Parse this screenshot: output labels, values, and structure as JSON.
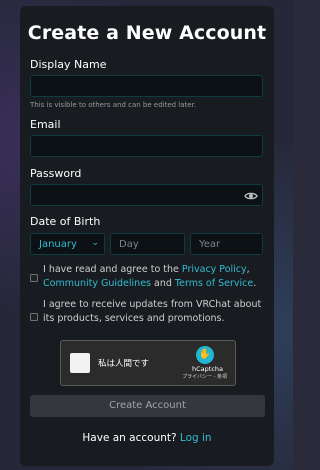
{
  "title": "Create a New Account",
  "display_name": {
    "label": "Display Name",
    "value": "",
    "hint": "This is visible to others and can be edited later."
  },
  "email": {
    "label": "Email",
    "value": ""
  },
  "password": {
    "label": "Password",
    "value": "",
    "toggle_icon": "eye-icon"
  },
  "dob": {
    "label": "Date of Birth",
    "month": "January",
    "day_placeholder": "Day",
    "year_placeholder": "Year"
  },
  "agree_tos": {
    "checked": false,
    "text_before": "I have read and agree to the ",
    "privacy": "Privacy Policy",
    "comma": ",",
    "community": "Community Guidelines",
    "and": " and ",
    "terms": "Terms of Service",
    "period": "."
  },
  "agree_updates": {
    "checked": false,
    "text": "I agree to receive updates from VRChat about its products, services and promotions."
  },
  "captcha": {
    "label": "私は人間です",
    "brand": "hCaptcha",
    "legal": "プライバシー - 条項"
  },
  "submit": "Create Account",
  "footer": {
    "text": "Have an account? ",
    "link": "Log in"
  },
  "colors": {
    "accent": "#30bdd4",
    "panel": "#181b1f",
    "field_bg": "#0b1114"
  }
}
